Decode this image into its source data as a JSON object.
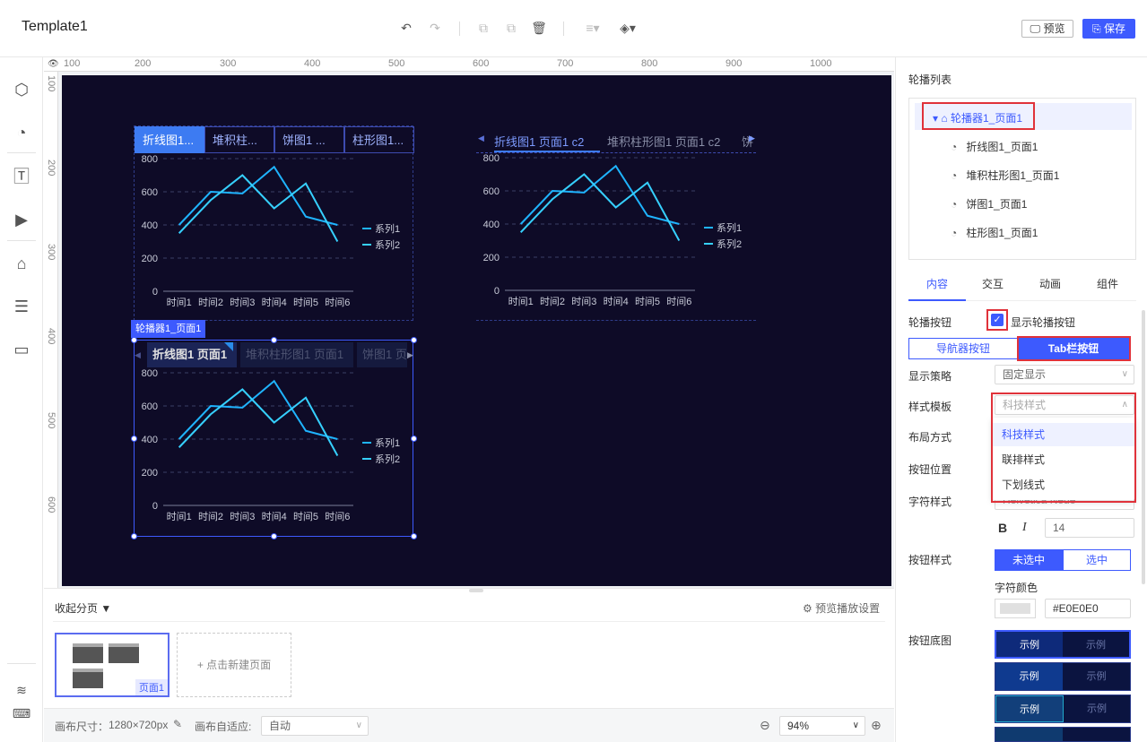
{
  "app": {
    "title": "Template1"
  },
  "toolbar": {
    "preview_label": "预览",
    "save_label": "保存",
    "icons": [
      "undo-icon",
      "redo-icon",
      "copy-icon",
      "paste-icon",
      "delete-icon",
      "align-icon",
      "layers-icon"
    ]
  },
  "left_rail": {
    "icons": [
      "cube-icon",
      "chart-icon",
      "text-icon",
      "video-icon",
      "inbox-icon",
      "table-icon",
      "archive-icon",
      "layers-icon",
      "keyboard-icon"
    ]
  },
  "ruler": {
    "top": [
      "100",
      "200",
      "300",
      "400",
      "500",
      "600",
      "700",
      "800",
      "900",
      "1000"
    ],
    "left": [
      "100",
      "200",
      "300",
      "400",
      "500",
      "600"
    ]
  },
  "canvas": {
    "chart1": {
      "tabs": [
        "折线图1...",
        "堆积柱...",
        "饼图1 ...",
        "柱形图1..."
      ],
      "active_tab": 0
    },
    "chart2": {
      "tabs": [
        "折线图1 页面1 c2",
        "堆积柱形图1 页面1 c2",
        "饼"
      ],
      "active_tab": 0
    },
    "chart3": {
      "badge": "轮播器1_页面1",
      "tabs": [
        "折线图1 页面1",
        "堆积柱形图1 页面1",
        "饼图1 页"
      ],
      "active_tab": 0
    }
  },
  "chart_data": {
    "type": "line",
    "categories": [
      "时间1",
      "时间2",
      "时间3",
      "时间4",
      "时间5",
      "时间6"
    ],
    "series": [
      {
        "name": "系列1",
        "values": [
          400,
          600,
          590,
          750,
          450,
          400
        ],
        "color": "#1fb4ff"
      },
      {
        "name": "系列2",
        "values": [
          350,
          550,
          700,
          500,
          650,
          300
        ],
        "color": "#36d0ff"
      }
    ],
    "ylim": [
      0,
      800
    ],
    "yticks": [
      0,
      200,
      400,
      600,
      800
    ],
    "legend": "right",
    "grid": true
  },
  "pages_panel": {
    "collapse_label": "收起分页",
    "preview_settings": "预览播放设置",
    "page_label": "页面1",
    "new_page": "+ 点击新建页面"
  },
  "status": {
    "canvas_size_label": "画布尺寸：",
    "canvas_size": "1280×720px",
    "adapt_label": "画布自适应:",
    "adapt_value": "自动",
    "zoom": "94%"
  },
  "right_panel": {
    "list_title": "轮播列表",
    "tree_root": "轮播器1_页面1",
    "tree_items": [
      "折线图1_页面1",
      "堆积柱形图1_页面1",
      "饼图1_页面1",
      "柱形图1_页面1"
    ],
    "tabs": [
      "内容",
      "交互",
      "动画",
      "组件"
    ],
    "active_tab": 0,
    "carousel_btn_label": "轮播按钮",
    "show_carousel_btn": "显示轮播按钮",
    "nav_btn": "导航器按钮",
    "tab_btn": "Tab栏按钮",
    "display_strategy_label": "显示策略",
    "display_strategy_value": "固定显示",
    "style_template_label": "样式模板",
    "style_template_value": "科技样式",
    "style_options": [
      "科技样式",
      "联排样式",
      "下划线式"
    ],
    "layout_label": "布局方式",
    "btn_position_label": "按钮位置",
    "font_style_label": "字符样式",
    "font_partial": "Helvetica Neue",
    "bold": "B",
    "italic": "I",
    "font_size": "14",
    "btn_style_label": "按钮样式",
    "unselected": "未选中",
    "selected": "选中",
    "font_color_label": "字符颜色",
    "font_color_value": "#E0E0E0",
    "btn_bg_label": "按钮底图",
    "example": "示例"
  }
}
